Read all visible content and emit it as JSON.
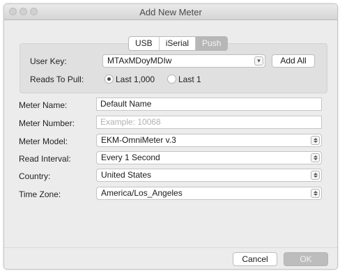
{
  "window": {
    "title": "Add New Meter"
  },
  "tabs": [
    {
      "label": "USB",
      "active": false
    },
    {
      "label": "iSerial",
      "active": false
    },
    {
      "label": "Push",
      "active": true
    }
  ],
  "push_panel": {
    "user_key_label": "User Key:",
    "user_key_value": "MTAxMDoyMDIw",
    "add_all_label": "Add All",
    "reads_label": "Reads To Pull:",
    "reads_options": [
      {
        "label": "Last 1,000",
        "selected": true
      },
      {
        "label": "Last 1",
        "selected": false
      }
    ]
  },
  "form": {
    "meter_name": {
      "label": "Meter Name:",
      "value": "Default Name"
    },
    "meter_number": {
      "label": "Meter Number:",
      "value": "",
      "placeholder": "Example: 10068"
    },
    "meter_model": {
      "label": "Meter Model:",
      "value": "EKM-OmniMeter v.3"
    },
    "read_interval": {
      "label": "Read Interval:",
      "value": "Every 1 Second"
    },
    "country": {
      "label": "Country:",
      "value": "United States"
    },
    "time_zone": {
      "label": "Time Zone:",
      "value": "America/Los_Angeles"
    }
  },
  "footer": {
    "cancel_label": "Cancel",
    "ok_label": "OK"
  },
  "icons": {
    "select_arrow": "chevron-down-icon",
    "popup_stepper": "up-down-arrows-icon"
  }
}
